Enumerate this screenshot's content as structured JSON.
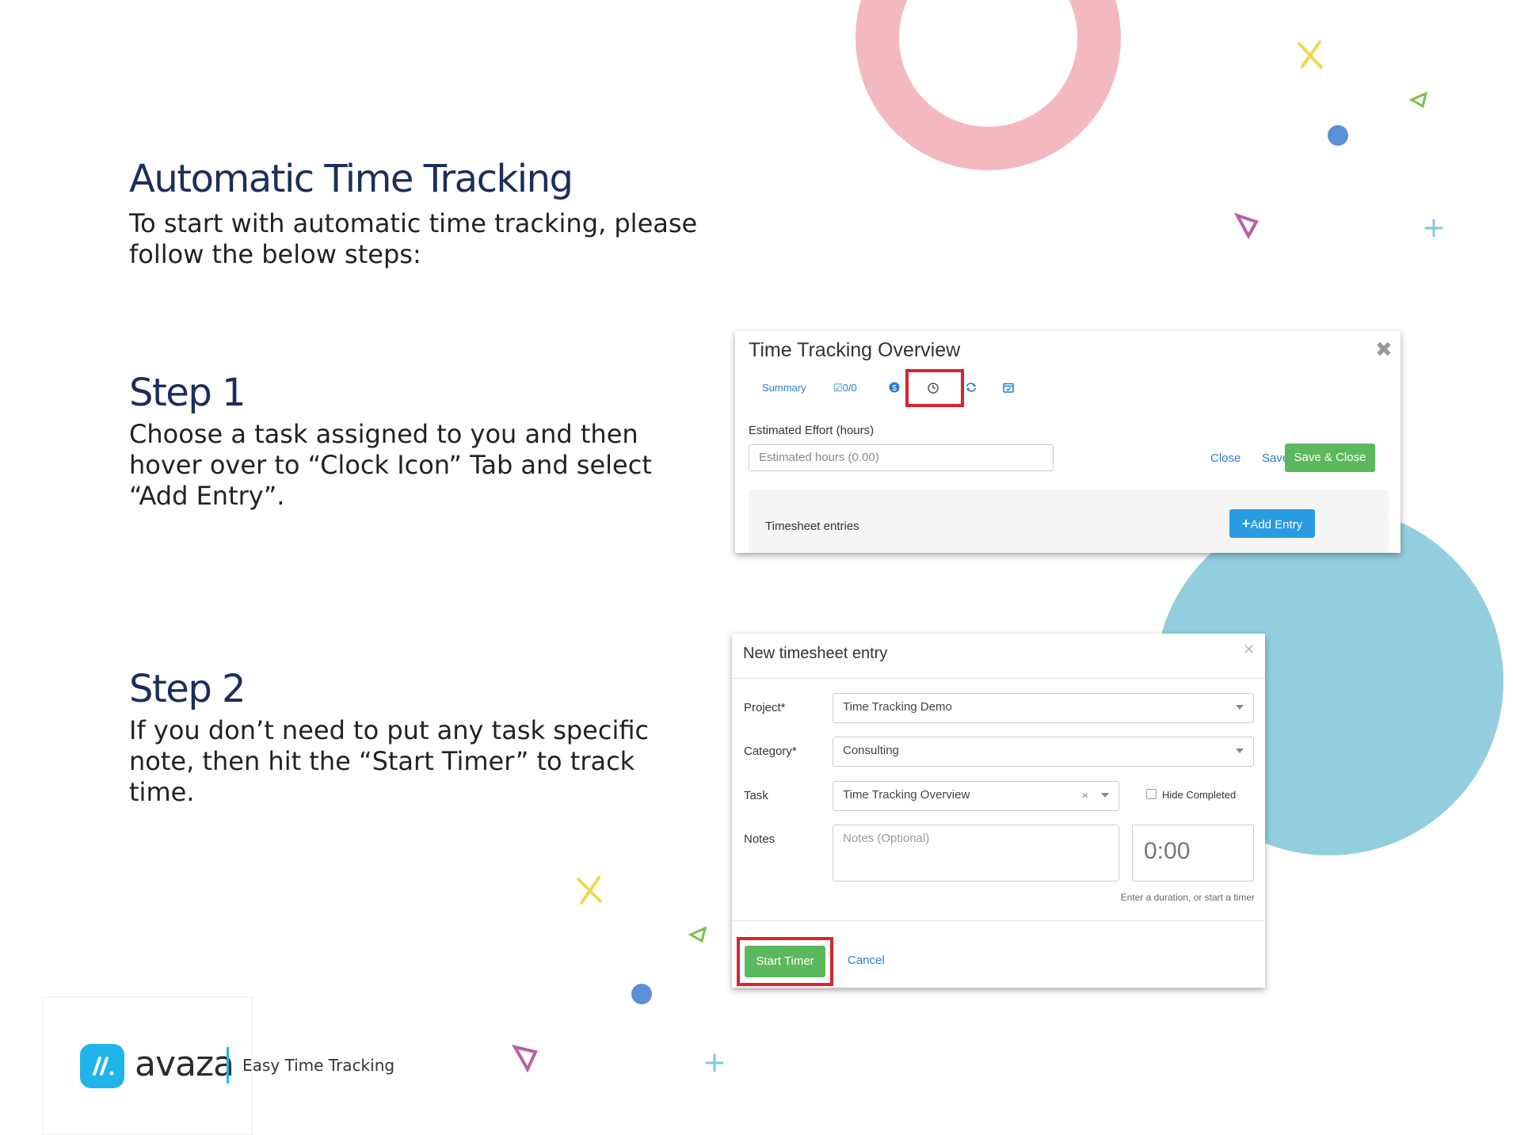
{
  "intro": {
    "title": "Automatic Time  Tracking",
    "text": "To start with automatic time tracking, please follow the below steps:"
  },
  "step1": {
    "title": "Step 1",
    "text": "Choose a task assigned to you and then hover over to “Clock Icon” Tab and select “Add Entry”."
  },
  "step2": {
    "title": "Step 2",
    "text": "If you don’t need to put any task specific note, then hit the “Start Timer” to track time."
  },
  "overview_panel": {
    "title": "Time Tracking Overview",
    "tabs": [
      "Summary",
      "0/0"
    ],
    "estimated_label": "Estimated Effort (hours)",
    "estimated_placeholder": "Estimated hours (0.00)",
    "close_label": "Close",
    "save_label": "Save",
    "save_close_label": "Save & Close",
    "timesheet_label": "Timesheet entries",
    "add_entry_label": "Add Entry"
  },
  "entry_dialog": {
    "title": "New timesheet entry",
    "project_label": "Project*",
    "project_value": "Time Tracking Demo",
    "category_label": "Category*",
    "category_value": "Consulting",
    "task_label": "Task",
    "task_value": "Time Tracking Overview",
    "hide_completed_label": "Hide Completed",
    "notes_label": "Notes",
    "notes_placeholder": "Notes (Optional)",
    "duration_value": "0:00",
    "duration_hint": "Enter a duration, or start a timer",
    "start_timer_label": "Start Timer",
    "cancel_label": "Cancel"
  },
  "logo": {
    "name": "avaza",
    "tagline": "Easy Time Tracking"
  },
  "colors": {
    "heading": "#1c2e5a",
    "highlight": "#d9232f",
    "green_button": "#5cb85c",
    "blue_button": "#2a9be0",
    "link": "#2a7dd3",
    "ring": "#f4b9c0",
    "circle": "#93cedf",
    "brand": "#1fb5e8"
  }
}
